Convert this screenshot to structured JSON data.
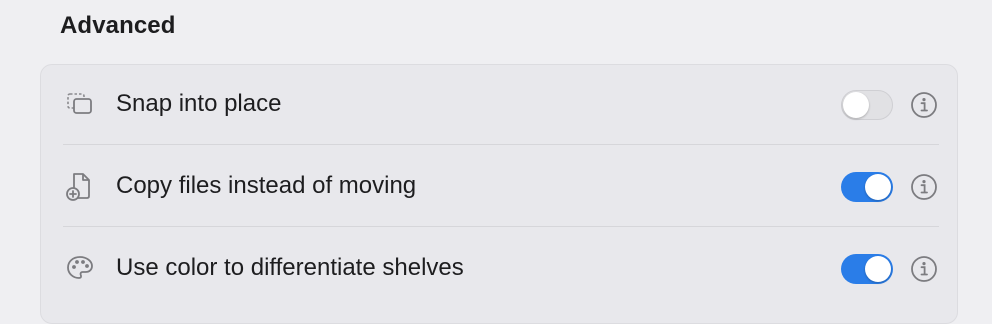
{
  "section": {
    "title": "Advanced"
  },
  "settings": [
    {
      "label": "Snap into place",
      "icon": "snap-window-icon",
      "enabled": false
    },
    {
      "label": "Copy files instead of moving",
      "icon": "document-add-icon",
      "enabled": true
    },
    {
      "label": "Use color to differentiate shelves",
      "icon": "palette-icon",
      "enabled": true
    }
  ],
  "colors": {
    "toggle_on": "#2a7de8",
    "toggle_off": "#e1e1e4",
    "panel": "#e8e8ec",
    "background": "#efeff2"
  }
}
